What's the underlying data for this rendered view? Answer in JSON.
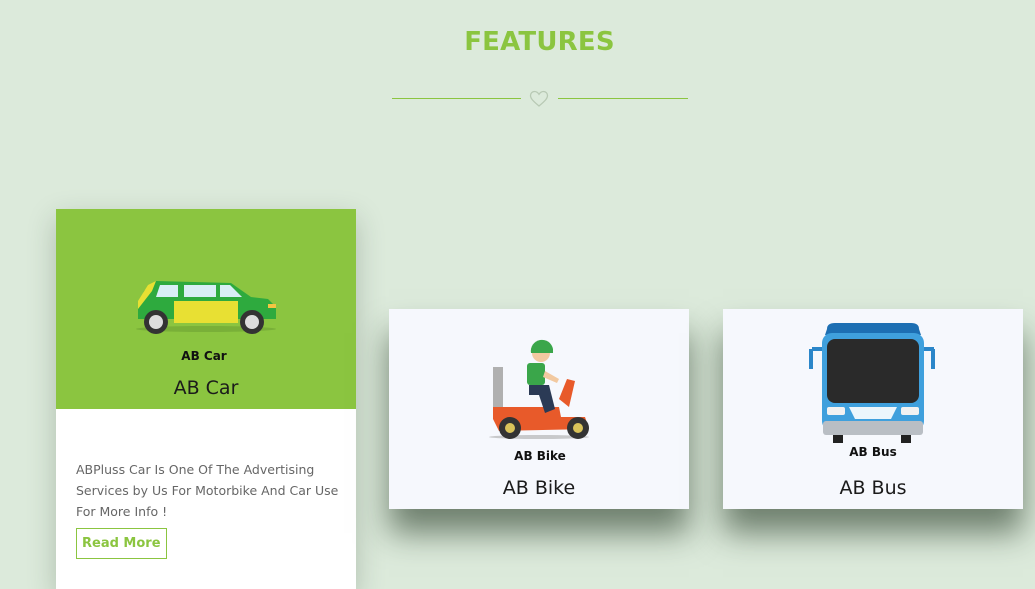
{
  "section": {
    "title": "FEATURES"
  },
  "cards": [
    {
      "title": "AB Car",
      "image_caption": "AB Car",
      "description": "ABPluss Car Is One Of The Advertising Services by Us For Motorbike And Car Use For More Info !",
      "button": "Read More"
    },
    {
      "title": "AB Bike",
      "image_caption": "AB Bike"
    },
    {
      "title": "AB Bus",
      "image_caption": "AB Bus"
    }
  ],
  "colors": {
    "accent": "#8bc540",
    "background": "#dceadb",
    "card": "#f6f8fd"
  },
  "icons": [
    "heart-icon"
  ]
}
